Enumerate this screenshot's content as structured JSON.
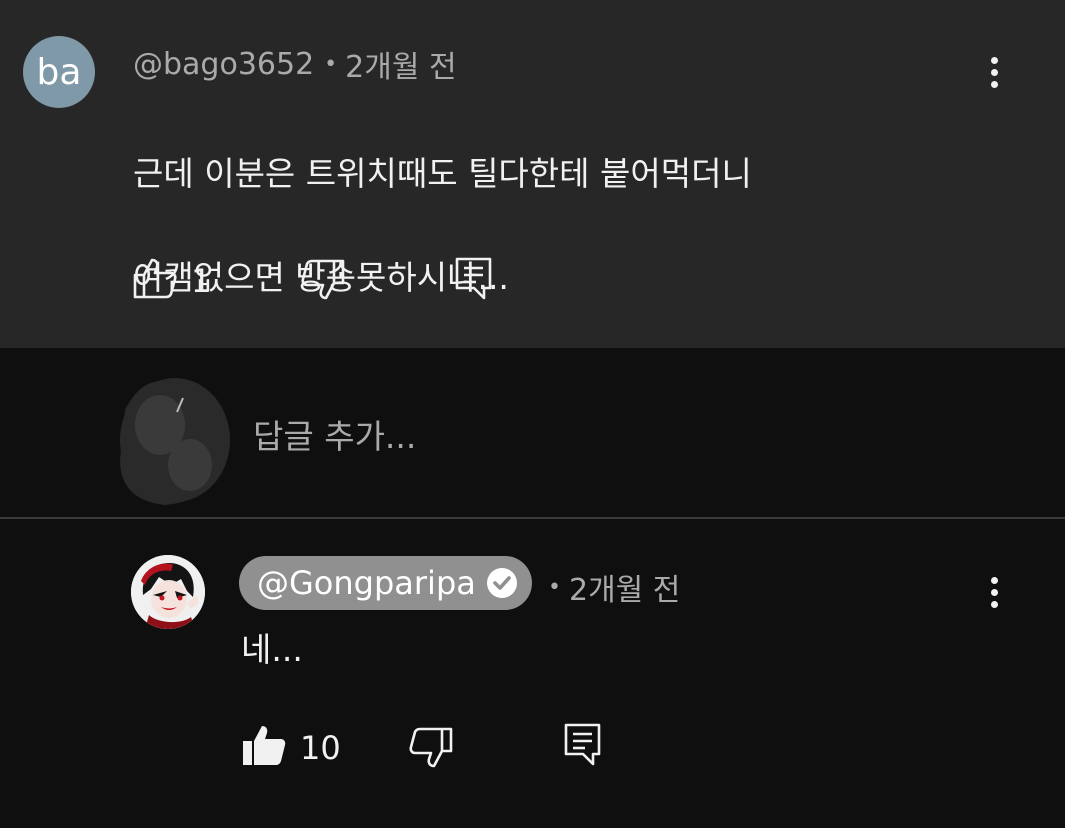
{
  "comment": {
    "avatar_initials": "ba",
    "author": "@bago3652",
    "separator": "•",
    "time": "2개월 전",
    "text_line1": "근데 이분은 트위치때도 틸다한테 붙어먹더니",
    "text_line2": "여캠없으면 방송못하시나...",
    "like_count": "1"
  },
  "reply_box": {
    "placeholder": "답글 추가..."
  },
  "reply": {
    "author": "@Gongparipa",
    "separator": "•",
    "time": "2개월 전",
    "text": "네...",
    "like_count": "10"
  },
  "colors": {
    "card_bg": "#272727",
    "page_bg": "#0f0f0f",
    "author_pill": "#909090",
    "avatar_ba": "#7f99a8"
  }
}
